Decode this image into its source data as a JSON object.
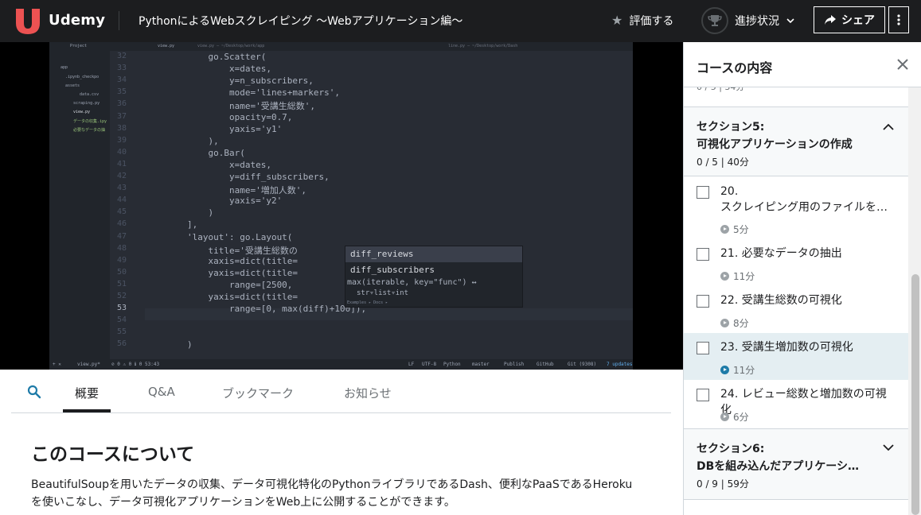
{
  "header": {
    "brand": "Udemy",
    "course_title": "PythonによるWebスクレイピング ～Webアプリケーション編～",
    "rate_label": "評価する",
    "progress_label": "進捗状況",
    "share_label": "シェア"
  },
  "ide": {
    "tabs": [
      "Project",
      "view.py",
      "line.py — ~/Desktop/work/Dash"
    ],
    "tab_path": "view.py — ~/Desktop/work/app",
    "tree": [
      "app",
      ".ipynb_checkpo",
      "assets",
      "data.csv",
      "scraping.py",
      "view.py",
      "データの収集.ipy",
      "必要なデータの抽"
    ],
    "line_numbers": [
      "32",
      "33",
      "34",
      "35",
      "36",
      "37",
      "38",
      "39",
      "40",
      "41",
      "42",
      "43",
      "44",
      "45",
      "46",
      "47",
      "48",
      "49",
      "50",
      "51",
      "52",
      "53",
      "54",
      "55",
      "56"
    ],
    "code": [
      "            go.Scatter(",
      "                x=dates,",
      "                y=n_subscribers,",
      "                mode='lines+markers',",
      "                name='受講生総数',",
      "                opacity=0.7,",
      "                yaxis='y1'",
      "            ),",
      "            go.Bar(",
      "                x=dates,",
      "                y=diff_subscribers,",
      "                name='増加人数',",
      "                yaxis='y2'",
      "            )",
      "        ],",
      "        'layout': go.Layout(",
      "            title='受講生総数の",
      "            xaxis=dict(title=",
      "            yaxis=dict(title=                             lse,",
      "                range=[2500,",
      "            yaxis=dict(title=                             se,",
      "                range=[0, max(diff)+100]),",
      "",
      "",
      "        )"
    ],
    "autocomplete": {
      "items": [
        "diff_reviews",
        "diff_subscribers"
      ],
      "signature": "max(iterable, key=\"func\") ↔",
      "types": "str▿list▿int",
      "doc": "Examples ▸  Docs ▸"
    },
    "status": {
      "file": "view.py*",
      "errors": "⊘ 0 ⚠ 0 ℹ 0",
      "position": "53:43",
      "eol": "LF",
      "encoding": "UTF-8",
      "grammar": "Python",
      "branch": "master",
      "publish": "Publish",
      "github": "GitHub",
      "git": "Git (9308)",
      "updates": "7 updates"
    }
  },
  "tabs": [
    "概要",
    "Q&A",
    "ブックマーク",
    "お知らせ"
  ],
  "about": {
    "title": "このコースについて",
    "description": "BeautifulSoupを用いたデータの収集、データ可視化特化のPythonライブラリであるDash、便利なPaaSであるHerokuを使いこなし、データ可視化アプリケーションをWeb上に公開することができます。"
  },
  "sidebar": {
    "title": "コースの内容",
    "clipped_meta": "0 / 5 | 34分",
    "sections": [
      {
        "title_line1": "セクション5:",
        "title_line2": "可視化アプリケーションの作成",
        "meta": "0 / 5 | 40分",
        "expanded": true
      },
      {
        "title_line1": "セクション6:",
        "title_line2": "DBを組み込んだアプリケーシ…",
        "meta": "0 / 9 | 59分",
        "expanded": false
      }
    ],
    "lectures": [
      {
        "title": "20.\nスクレイピング用のファイルを…",
        "duration": "5分",
        "current": false
      },
      {
        "title": "21. 必要なデータの抽出",
        "duration": "11分",
        "current": false
      },
      {
        "title": "22. 受講生総数の可視化",
        "duration": "8分",
        "current": false
      },
      {
        "title": "23. 受講生増加数の可視化",
        "duration": "11分",
        "current": true
      },
      {
        "title": "24. レビュー総数と増加数の可視化",
        "duration": "6分",
        "current": false
      }
    ]
  }
}
